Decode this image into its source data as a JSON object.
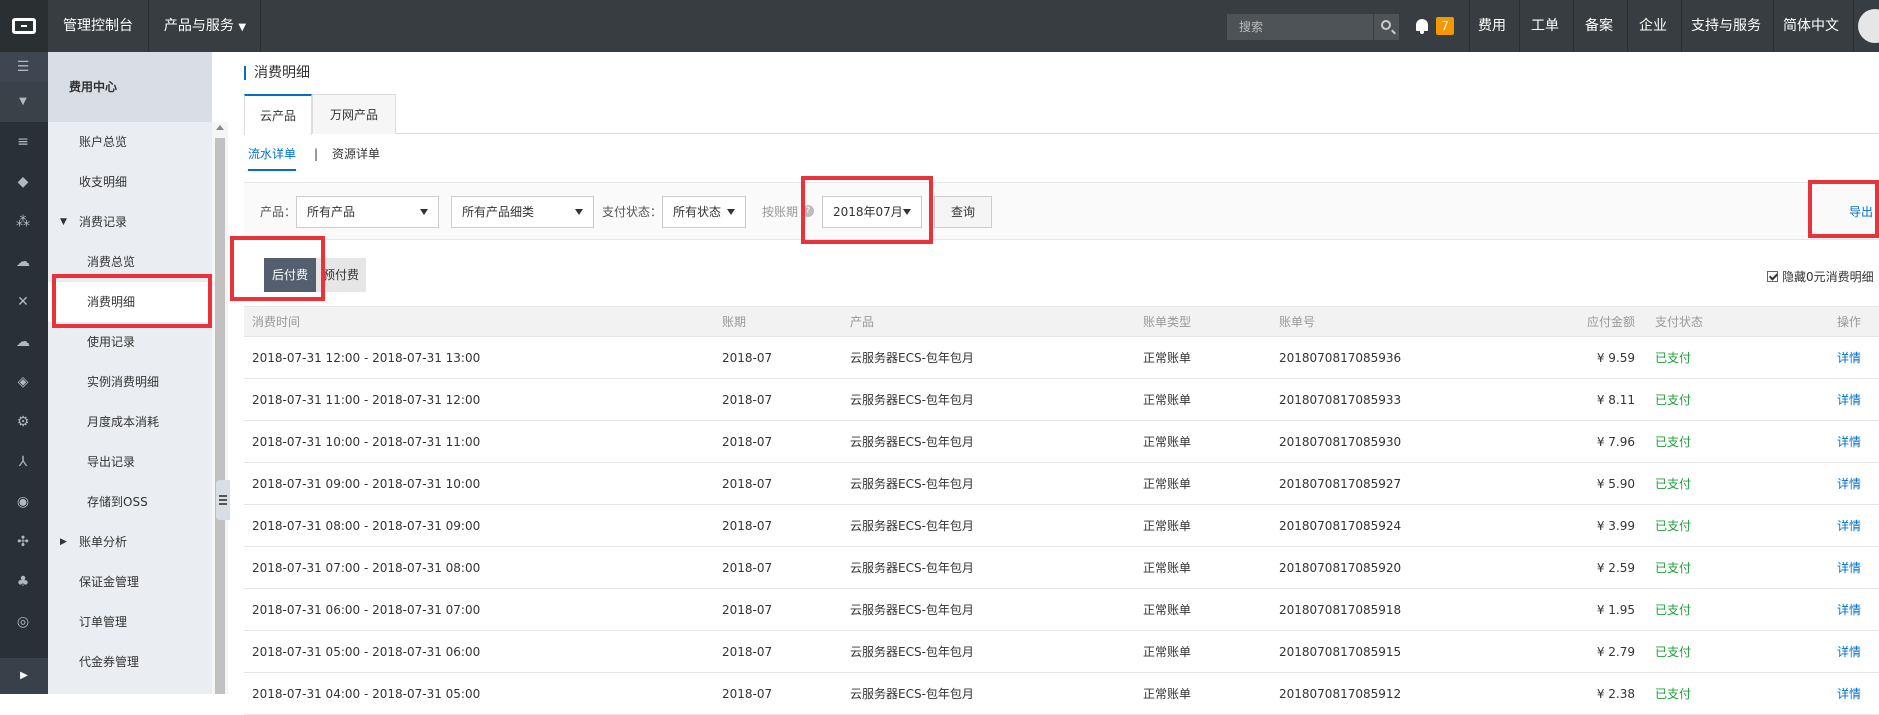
{
  "topbar": {
    "console": "管理控制台",
    "products": "产品与服务",
    "search_placeholder": "搜索",
    "notif_count": "7",
    "nav": [
      "费用",
      "工单",
      "备案",
      "企业",
      "支持与服务",
      "简体中文"
    ]
  },
  "iconbar": {
    "icons": [
      "menu-icon",
      "chevron-down-icon",
      "server-icon",
      "database-icon",
      "network-icon",
      "cloud-upload-icon",
      "cross-arrows-icon",
      "cloud-icon",
      "cube-icon",
      "gear-icon",
      "tree-icon",
      "eye-icon",
      "nodes-icon",
      "cluster-icon",
      "settings-icon",
      "chevron-right-icon"
    ]
  },
  "sidebar": {
    "header": "费用中心",
    "items": [
      {
        "label": "账户总览",
        "level": 1
      },
      {
        "label": "收支明细",
        "level": 1
      },
      {
        "label": "消费记录",
        "level": 1,
        "expanded": true
      },
      {
        "label": "消费总览",
        "level": 2
      },
      {
        "label": "消费明细",
        "level": 2,
        "active": true
      },
      {
        "label": "使用记录",
        "level": 2
      },
      {
        "label": "实例消费明细",
        "level": 2
      },
      {
        "label": "月度成本消耗",
        "level": 2
      },
      {
        "label": "导出记录",
        "level": 2
      },
      {
        "label": "存储到OSS",
        "level": 2
      },
      {
        "label": "账单分析",
        "level": 1,
        "collapsed": true
      },
      {
        "label": "保证金管理",
        "level": 1
      },
      {
        "label": "订单管理",
        "level": 1
      },
      {
        "label": "代金券管理",
        "level": 1
      }
    ]
  },
  "main": {
    "title": "消费明细",
    "tabs": [
      "云产品",
      "万网产品"
    ],
    "subtabs": [
      "流水详单",
      "资源详单"
    ],
    "subtab_sep": "|",
    "filters": {
      "product_label": "产品：",
      "product_value": "所有产品",
      "category_value": "所有产品细类",
      "status_label": "支付状态：",
      "status_value": "所有状态",
      "period_label": "按账期",
      "help": "?",
      "period_value": "2018年07月",
      "query_button": "查询",
      "export_link": "导出"
    },
    "bill_types": [
      "后付费",
      "预付费"
    ],
    "hide_zero": "隐藏0元消费明细",
    "table": {
      "headers": [
        "消费时间",
        "账期",
        "产品",
        "账单类型",
        "账单号",
        "应付金额",
        "支付状态",
        "操作"
      ],
      "rows": [
        [
          "2018-07-31 12:00 - 2018-07-31 13:00",
          "2018-07",
          "云服务器ECS-包年包月",
          "正常账单",
          "2018070817085936",
          "¥ 9.59",
          "已支付",
          "详情"
        ],
        [
          "2018-07-31 11:00 - 2018-07-31 12:00",
          "2018-07",
          "云服务器ECS-包年包月",
          "正常账单",
          "2018070817085933",
          "¥ 8.11",
          "已支付",
          "详情"
        ],
        [
          "2018-07-31 10:00 - 2018-07-31 11:00",
          "2018-07",
          "云服务器ECS-包年包月",
          "正常账单",
          "2018070817085930",
          "¥ 7.96",
          "已支付",
          "详情"
        ],
        [
          "2018-07-31 09:00 - 2018-07-31 10:00",
          "2018-07",
          "云服务器ECS-包年包月",
          "正常账单",
          "2018070817085927",
          "¥ 5.90",
          "已支付",
          "详情"
        ],
        [
          "2018-07-31 08:00 - 2018-07-31 09:00",
          "2018-07",
          "云服务器ECS-包年包月",
          "正常账单",
          "2018070817085924",
          "¥ 3.99",
          "已支付",
          "详情"
        ],
        [
          "2018-07-31 07:00 - 2018-07-31 08:00",
          "2018-07",
          "云服务器ECS-包年包月",
          "正常账单",
          "2018070817085920",
          "¥ 2.59",
          "已支付",
          "详情"
        ],
        [
          "2018-07-31 06:00 - 2018-07-31 07:00",
          "2018-07",
          "云服务器ECS-包年包月",
          "正常账单",
          "2018070817085918",
          "¥ 1.95",
          "已支付",
          "详情"
        ],
        [
          "2018-07-31 05:00 - 2018-07-31 06:00",
          "2018-07",
          "云服务器ECS-包年包月",
          "正常账单",
          "2018070817085915",
          "¥ 2.79",
          "已支付",
          "详情"
        ],
        [
          "2018-07-31 04:00 - 2018-07-31 05:00",
          "2018-07",
          "云服务器ECS-包年包月",
          "正常账单",
          "2018070817085912",
          "¥ 2.38",
          "已支付",
          "详情"
        ]
      ]
    }
  },
  "colors": {
    "topbar": "#373d41",
    "accent": "#0070cc",
    "highlight": "#e8333a",
    "paid": "#1e9f3a"
  }
}
